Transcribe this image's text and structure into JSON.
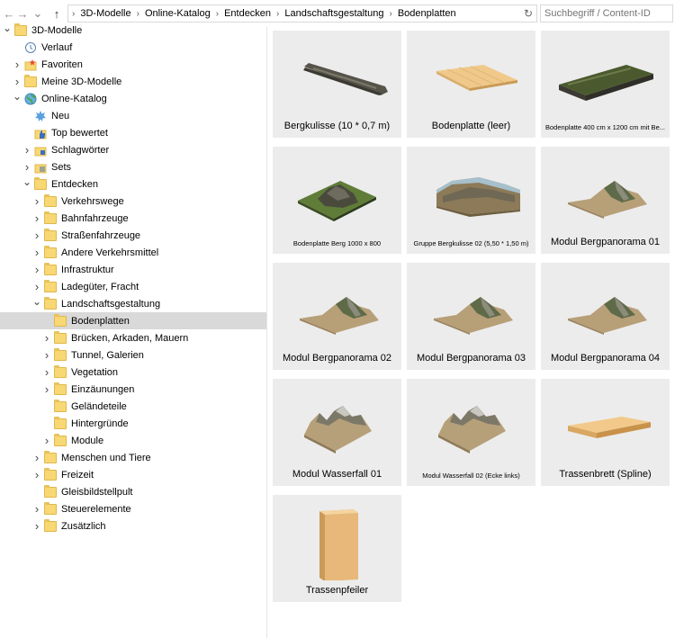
{
  "nav": {
    "back_icon": "←",
    "forward_icon": "→",
    "dropdown_icon": "⌄",
    "up_icon": "↑"
  },
  "breadcrumb": [
    "3D-Modelle",
    "Online-Katalog",
    "Entdecken",
    "Landschaftsgestaltung",
    "Bodenplatten"
  ],
  "refresh_icon": "↻",
  "search": {
    "placeholder": "Suchbegriff / Content-ID"
  },
  "tree": [
    {
      "label": "3D-Modelle",
      "expanded": true,
      "icon": "folder"
    },
    {
      "label": "Verlauf",
      "icon": "history-icon"
    },
    {
      "label": "Favoriten",
      "icon": "favorites-icon"
    },
    {
      "label": "Meine 3D-Modelle",
      "icon": "folder"
    },
    {
      "label": "Online-Katalog",
      "expanded": true,
      "icon": "globe-icon"
    },
    {
      "label": "Neu",
      "icon": "new-icon"
    },
    {
      "label": "Top bewertet",
      "icon": "thumbs-up-icon"
    },
    {
      "label": "Schlagwörter",
      "icon": "tag-icon"
    },
    {
      "label": "Sets",
      "icon": "sets-icon"
    },
    {
      "label": "Entdecken",
      "expanded": true,
      "icon": "folder"
    },
    {
      "label": "Verkehrswege",
      "icon": "folder"
    },
    {
      "label": "Bahnfahrzeuge",
      "icon": "folder"
    },
    {
      "label": "Straßenfahrzeuge",
      "icon": "folder"
    },
    {
      "label": "Andere Verkehrsmittel",
      "icon": "folder"
    },
    {
      "label": "Infrastruktur",
      "icon": "folder"
    },
    {
      "label": "Ladegüter, Fracht",
      "icon": "folder"
    },
    {
      "label": "Landschaftsgestaltung",
      "expanded": true,
      "icon": "folder"
    },
    {
      "label": "Bodenplatten",
      "selected": true,
      "icon": "folder"
    },
    {
      "label": "Brücken, Arkaden, Mauern",
      "icon": "folder"
    },
    {
      "label": "Tunnel, Galerien",
      "icon": "folder"
    },
    {
      "label": "Vegetation",
      "icon": "folder"
    },
    {
      "label": "Einzäunungen",
      "icon": "folder"
    },
    {
      "label": "Geländeteile",
      "icon": "folder"
    },
    {
      "label": "Hintergründe",
      "icon": "folder"
    },
    {
      "label": "Module",
      "icon": "folder"
    },
    {
      "label": "Menschen und Tiere",
      "icon": "folder"
    },
    {
      "label": "Freizeit",
      "icon": "folder"
    },
    {
      "label": "Gleisbildstellpult",
      "icon": "folder"
    },
    {
      "label": "Steuerelemente",
      "icon": "folder"
    },
    {
      "label": "Zusätzlich",
      "icon": "folder"
    }
  ],
  "items": [
    {
      "label": "Bergkulisse (10 * 0,7 m)",
      "thumb": "rock-strip"
    },
    {
      "label": "Bodenplatte (leer)",
      "thumb": "plank"
    },
    {
      "label": "Bodenplatte 400 cm x 1200 cm mit Be...",
      "thumb": "grass-strip"
    },
    {
      "label": "Bodenplatte Berg 1000 x 800",
      "thumb": "grass-mountain"
    },
    {
      "label": "Gruppe Bergkulisse 02 (5,50 * 1,50 m)",
      "thumb": "panorama"
    },
    {
      "label": "Modul Bergpanorama 01",
      "thumb": "mountain"
    },
    {
      "label": "Modul Bergpanorama 02",
      "thumb": "mountain"
    },
    {
      "label": "Modul Bergpanorama 03",
      "thumb": "mountain"
    },
    {
      "label": "Modul Bergpanorama 04",
      "thumb": "mountain"
    },
    {
      "label": "Modul Wasserfall 01",
      "thumb": "peaks"
    },
    {
      "label": "Modul Wasserfall 02 (Ecke links)",
      "thumb": "peaks"
    },
    {
      "label": "Trassenbrett (Spline)",
      "thumb": "board"
    },
    {
      "label": "Trassenpfeiler",
      "thumb": "pillar"
    }
  ]
}
